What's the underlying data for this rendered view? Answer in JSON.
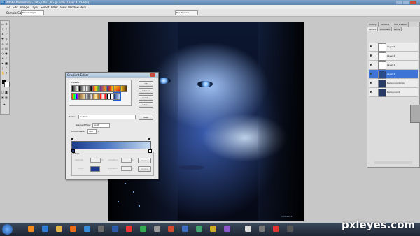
{
  "app": {
    "title": "Adobe Photoshop - [IMG_0037.JPG @ 50% (Layer 4, RGB/8)]",
    "menu": [
      "File",
      "Edit",
      "Image",
      "Layer",
      "Select",
      "Filter",
      "View",
      "Window",
      "Help"
    ]
  },
  "options": {
    "label": "Sample Size:",
    "sample_value": "Point Sample",
    "file_browser": "File Browser"
  },
  "dialog": {
    "title": "Gradient Editor",
    "presets_label": "Presets",
    "buttons": [
      "OK",
      "Cancel",
      "Load...",
      "Save..."
    ],
    "name_label": "Name:",
    "name_value": "Custom",
    "new_button": "New",
    "gradient_type_label": "Gradient Type:",
    "gradient_type_value": "Solid",
    "smoothness_label": "Smoothness:",
    "smoothness_value": "100",
    "smoothness_unit": "%",
    "stops_label": "Stops",
    "opacity_label": "Opacity:",
    "location_label": "Location:",
    "color_label": "Color:",
    "pct": "%",
    "delete_label": "Delete",
    "gradient_colors": [
      "#1d3b8c",
      "#4f78c3",
      "#c7dbf0"
    ]
  },
  "panels": {
    "top_tabs": [
      "History",
      "Actions",
      "Tool Presets"
    ],
    "tabs": [
      "Layers",
      "Channels",
      "Paths"
    ],
    "layers": [
      {
        "name": "Layer 5"
      },
      {
        "name": "Layer 2"
      },
      {
        "name": "Layer 1"
      },
      {
        "name": "Layer 4"
      },
      {
        "name": "Background copy"
      },
      {
        "name": "Background"
      }
    ]
  },
  "canvas": {
    "small_text": "1/30/2013"
  },
  "watermark": "pxleyes.com"
}
